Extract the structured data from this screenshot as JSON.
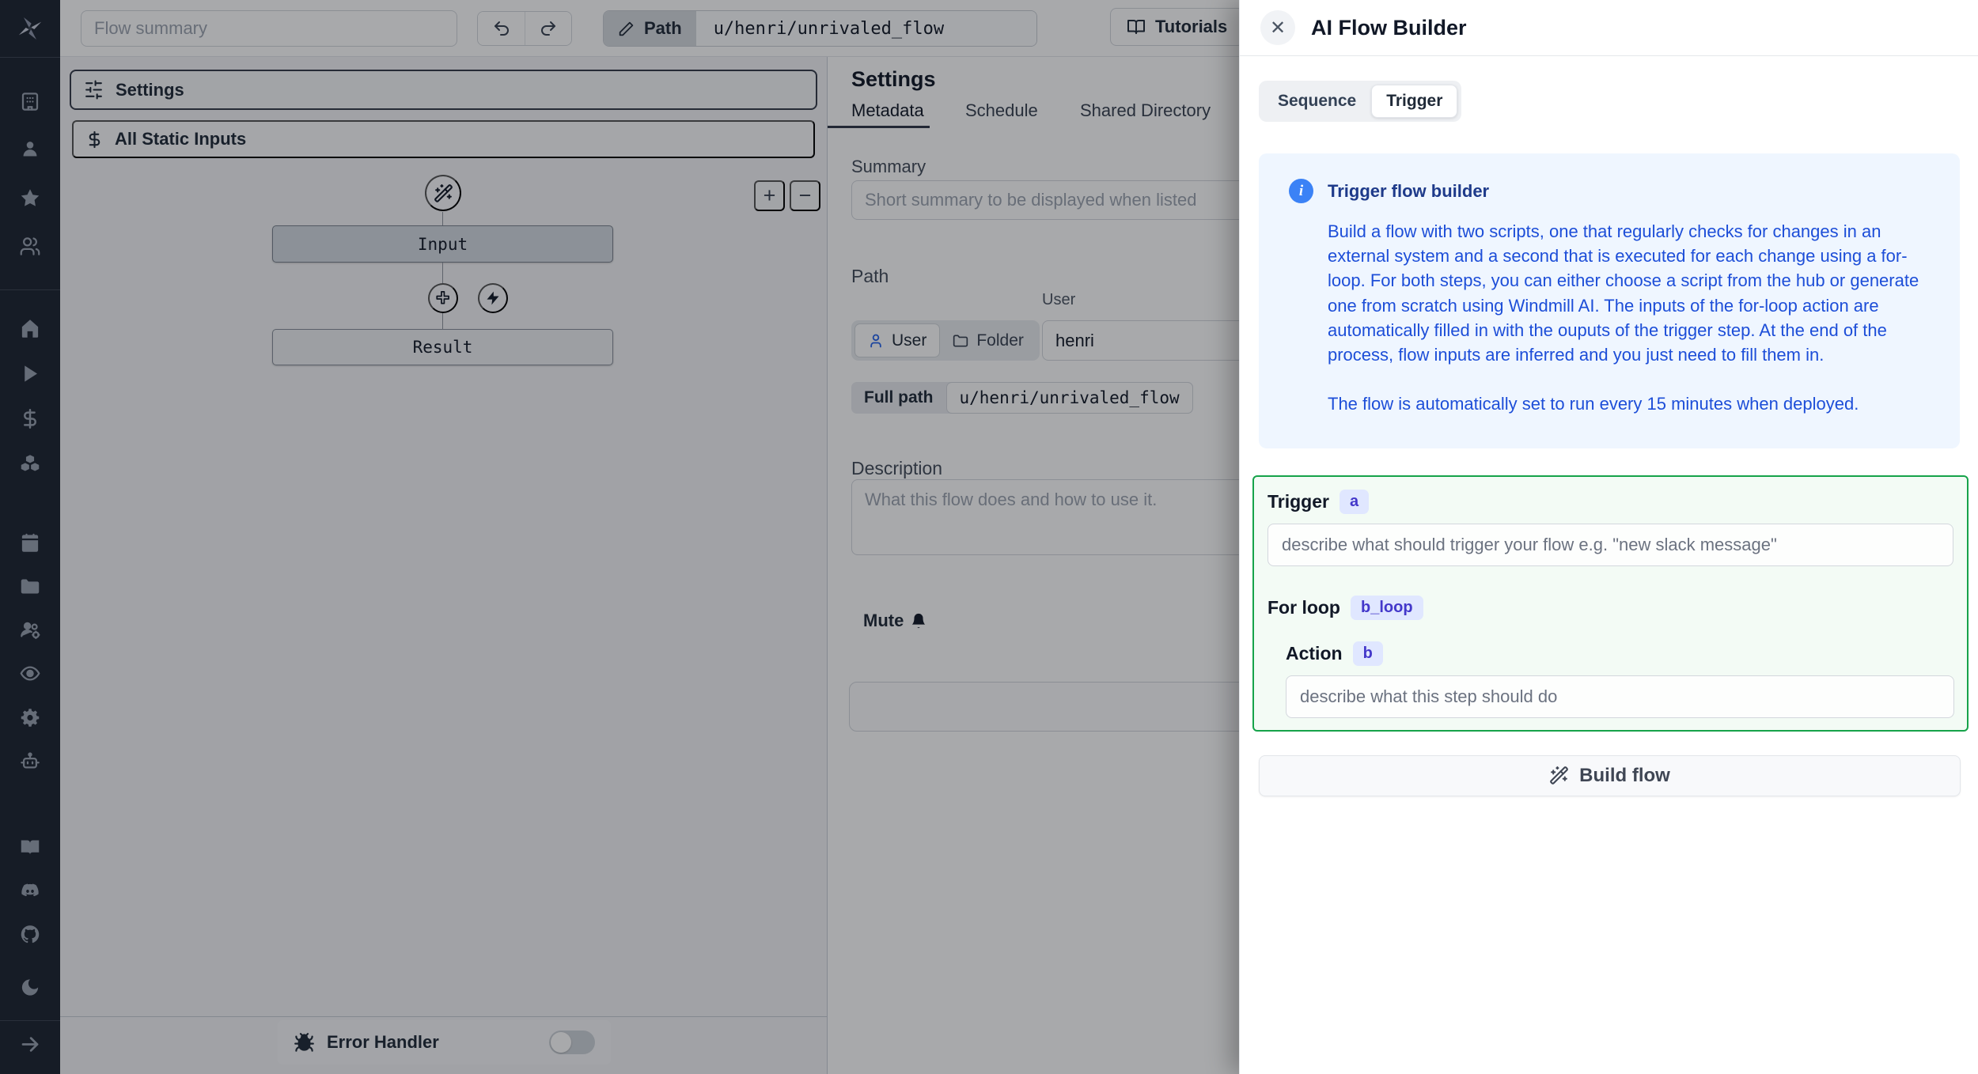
{
  "colors": {
    "accent_green": "#16a34a",
    "green_bg": "#f3fbf5",
    "info_bg": "#eff6ff",
    "info_title": "#1e3a8a",
    "info_text": "#1d4ed8",
    "badge_bg": "#e0e7ff",
    "badge_text": "#4338ca",
    "sidebar_bg": "#1c2330",
    "user_icon_blue": "#2563eb"
  },
  "sidebar": {
    "icons": [
      "windmill-logo",
      "workspace-icon",
      "user-icon",
      "favorites-star-icon",
      "team-icon",
      "home-icon",
      "runs-play-icon",
      "variables-dollar-icon",
      "resources-boxes-icon",
      "schedules-calendar-icon",
      "folders-icon",
      "groups-icon",
      "audit-eye-icon",
      "workers-gear-icon",
      "ai-robot-icon",
      "docs-book-icon",
      "discord-icon",
      "github-icon",
      "dark-mode-moon-icon",
      "expand-sidebar-arrow-icon"
    ]
  },
  "topbar": {
    "flow_summary_placeholder": "Flow summary",
    "path_label": "Path",
    "path_value": "u/henri/unrivaled_flow",
    "tutorials_label": "Tutorials"
  },
  "graph": {
    "settings_label": "Settings",
    "static_inputs_label": "All Static Inputs",
    "input_node_label": "Input",
    "result_node_label": "Result",
    "zoom_in_label": "+",
    "zoom_out_label": "−",
    "error_handler_label": "Error Handler"
  },
  "settings_panel": {
    "title": "Settings",
    "tabs": {
      "metadata": "Metadata",
      "schedule": "Schedule",
      "shared_directory": "Shared Directory"
    },
    "summary_label": "Summary",
    "summary_placeholder": "Short summary to be displayed when listed",
    "path_label": "Path",
    "user_field_label": "User",
    "user_value": "henri",
    "owner_toggle": {
      "user": "User",
      "folder": "Folder"
    },
    "full_path_label": "Full path",
    "full_path_value": "u/henri/unrivaled_flow",
    "description_label": "Description",
    "description_placeholder": "What this flow does and how to use it.",
    "mute_label": "Mute"
  },
  "drawer": {
    "title": "AI Flow Builder",
    "tabs": {
      "sequence": "Sequence",
      "trigger": "Trigger"
    },
    "info": {
      "title": "Trigger flow builder",
      "body": "Build a flow with two scripts, one that regularly checks for changes in an external system and a second that is executed for each change using a for-loop. For both steps, you can either choose a script from the hub or generate one from scratch using Windmill AI. The inputs of the for-loop action are automatically filled in with the ouputs of the trigger step. At the end of the process, flow inputs are inferred and you just need to fill them in.",
      "footer": "The flow is automatically set to run every 15 minutes when deployed."
    },
    "trigger_section": {
      "trigger_label": "Trigger",
      "trigger_badge": "a",
      "trigger_placeholder": "describe what should trigger your flow e.g. \"new slack message\"",
      "forloop_label": "For loop",
      "forloop_badge": "b_loop",
      "action_label": "Action",
      "action_badge": "b",
      "action_placeholder": "describe what this step should do"
    },
    "build_button_label": "Build flow"
  }
}
